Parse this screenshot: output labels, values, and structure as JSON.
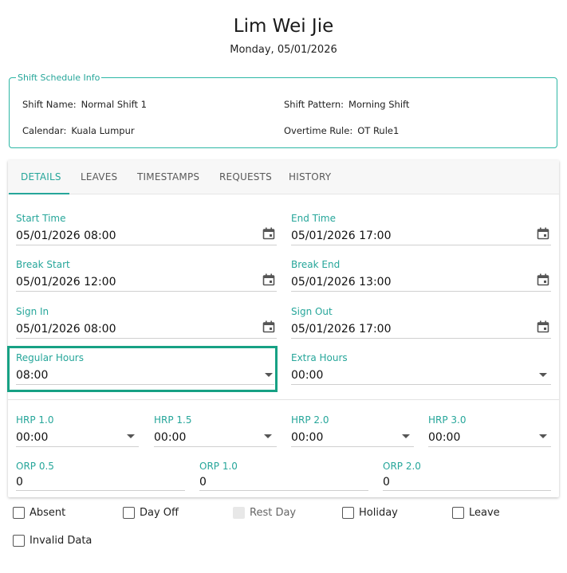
{
  "header": {
    "name": "Lim Wei Jie",
    "date": "Monday, 05/01/2026"
  },
  "shift_info": {
    "legend": "Shift Schedule Info",
    "shift_name_label": "Shift Name:",
    "shift_name": "Normal Shift 1",
    "shift_pattern_label": "Shift Pattern:",
    "shift_pattern": "Morning Shift",
    "calendar_label": "Calendar:",
    "calendar": "Kuala Lumpur",
    "overtime_rule_label": "Overtime Rule:",
    "overtime_rule": "OT Rule1"
  },
  "tabs": [
    {
      "label": "DETAILS",
      "active": true
    },
    {
      "label": "LEAVES",
      "active": false
    },
    {
      "label": "TIMESTAMPS",
      "active": false
    },
    {
      "label": "REQUESTS",
      "active": false
    },
    {
      "label": "HISTORY",
      "active": false
    }
  ],
  "details": {
    "start_time": {
      "label": "Start Time",
      "value": "05/01/2026 08:00"
    },
    "end_time": {
      "label": "End Time",
      "value": "05/01/2026 17:00"
    },
    "break_start": {
      "label": "Break Start",
      "value": "05/01/2026 12:00"
    },
    "break_end": {
      "label": "Break End",
      "value": "05/01/2026 13:00"
    },
    "sign_in": {
      "label": "Sign In",
      "value": "05/01/2026 08:00"
    },
    "sign_out": {
      "label": "Sign Out",
      "value": "05/01/2026 17:00"
    },
    "regular_hours": {
      "label": "Regular Hours",
      "value": "08:00"
    },
    "extra_hours": {
      "label": "Extra Hours",
      "value": "00:00"
    },
    "hrp_1_0": {
      "label": "HRP 1.0",
      "value": "00:00"
    },
    "hrp_1_5": {
      "label": "HRP 1.5",
      "value": "00:00"
    },
    "hrp_2_0": {
      "label": "HRP 2.0",
      "value": "00:00"
    },
    "hrp_3_0": {
      "label": "HRP 3.0",
      "value": "00:00"
    },
    "orp_0_5": {
      "label": "ORP 0.5",
      "value": "0"
    },
    "orp_1_0": {
      "label": "ORP 1.0",
      "value": "0"
    },
    "orp_2_0": {
      "label": "ORP 2.0",
      "value": "0"
    }
  },
  "checkboxes": {
    "absent": {
      "label": "Absent",
      "checked": false
    },
    "day_off": {
      "label": "Day Off",
      "checked": false
    },
    "rest_day": {
      "label": "Rest Day",
      "checked": false,
      "disabled": true
    },
    "holiday": {
      "label": "Holiday",
      "checked": false
    },
    "leave": {
      "label": "Leave",
      "checked": false
    },
    "invalid_data": {
      "label": "Invalid Data",
      "checked": false
    }
  },
  "colors": {
    "accent": "#26a69a",
    "highlight_border": "#17a184"
  },
  "icons": {
    "date_picker": "calendar-icon",
    "dropdown": "caret-down-icon"
  }
}
